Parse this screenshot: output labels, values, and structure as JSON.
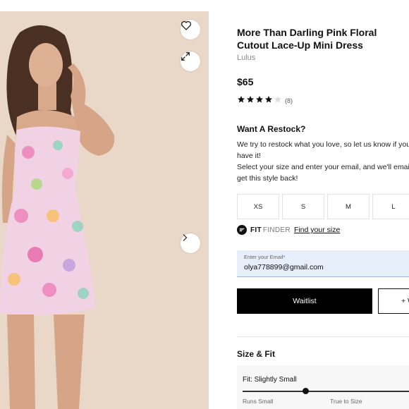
{
  "product": {
    "title": "More Than Darling Pink Floral Cutout Lace-Up Mini Dress",
    "brand": "Lulus",
    "price": "$65",
    "rating_stars": 4,
    "rating_max": 5,
    "rating_count": "(8)"
  },
  "photo": {
    "icons": [
      "heart-icon",
      "expand-icon",
      "chevron-right-icon"
    ],
    "background": "#e9d7c8"
  },
  "restock": {
    "heading": "Want A Restock?",
    "line1": "We try to restock what you love, so let us know if you",
    "line2": "have it!",
    "line3": "Select your size and enter your email, and we'll email",
    "line4": "get this style back!"
  },
  "sizes": [
    "XS",
    "S",
    "M",
    "L"
  ],
  "fit_finder": {
    "fit": "FIT",
    "finder": "FINDER",
    "link": "Find your size"
  },
  "email": {
    "label": "Enter your Email*",
    "value": "olya778899@gmail.com"
  },
  "actions": {
    "waitlist": "Waitlist",
    "wishlist": "+ W"
  },
  "size_fit": {
    "heading": "Size & Fit",
    "fit_label": "Fit: Slightly Small",
    "scale_min": "Runs Small",
    "scale_mid": "True to Size",
    "level": 0.37
  },
  "colors": {
    "accent": "#000000",
    "email_bg": "#e6eefa"
  }
}
